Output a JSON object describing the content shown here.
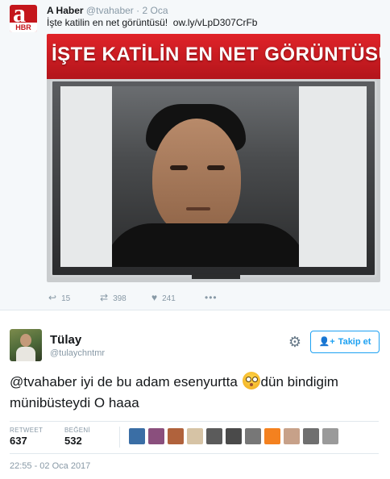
{
  "quoted_tweet": {
    "avatar_letter": "a",
    "avatar_badge": "HBR",
    "name": "A Haber",
    "handle": "@tvahaber",
    "separator": "·",
    "time": "2 Oca",
    "text": "İşte katilin en net görüntüsü!",
    "link": "ow.ly/vLpD307CrFb",
    "image_banner": "İŞTE KATİLİN EN NET GÖRÜNTÜSÜ",
    "actions": {
      "reply_count": "15",
      "retweet_count": "398",
      "like_count": "241"
    }
  },
  "tweet": {
    "name": "Tülay",
    "handle": "@tulaychntmr",
    "follow_label": "Takip et",
    "text_part1": "@tvahaber iyi de bu adam esenyurtta ",
    "text_part2": "dün bindigim münibüsteydi O haaa",
    "emoji_name": "flushed-face-emoji",
    "stats": {
      "retweet_label": "RETWEET",
      "retweet_count": "637",
      "like_label": "BEĞENİ",
      "like_count": "532"
    },
    "likers": [
      "#3a6ea5",
      "#8a4f7d",
      "#b0623c",
      "#d6c3a5",
      "#5b5b5b",
      "#4a4a4a",
      "#777777",
      "#f4811f",
      "#c7a189",
      "#6f6f6f",
      "#9a9a9a"
    ],
    "timestamp": "22:55 - 02 Oca 2017"
  },
  "colors": {
    "accent": "#1da1f2",
    "banner_red": "#e02329",
    "muted": "#8899a6"
  },
  "icons": [
    "reply-icon",
    "retweet-icon",
    "heart-icon",
    "more-icon",
    "gear-icon",
    "follow-user-icon"
  ]
}
